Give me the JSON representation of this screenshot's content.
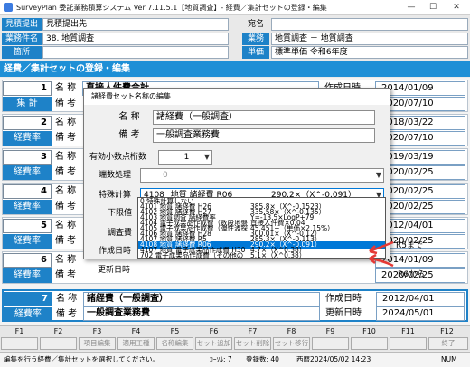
{
  "window": {
    "title": "SurveyPlan 委託業務積算システム Ver 7.11.5.1【地質調査】- 経費／集計セットの登録・編集",
    "min": "—",
    "max": "☐",
    "close": "✕"
  },
  "header": {
    "submitter_label": "見積提出先",
    "submitter_value": "見積提出先",
    "name_label": "宛名",
    "name_value": "",
    "work_label": "業務件名",
    "work_value": "38. 地質調査",
    "gyomu_label": "業務",
    "gyomu_value": "地質調査 － 地質調査",
    "place_label": "箇所",
    "place_value": "",
    "tanka_label": "単価",
    "tanka_value": "標準単価 令和6年度"
  },
  "section_title": "経費／集計セットの登録・編集",
  "rows": [
    {
      "num": "1",
      "kind": "集 計",
      "name_label": "名 称",
      "name": "直接人件費合計",
      "biko_label": "備 考",
      "biko": "",
      "created_label": "作成日時",
      "created": "2014/01/09",
      "updated_label": "更新日時",
      "updated": "2020/07/10"
    },
    {
      "num": "2",
      "kind": "経費率",
      "name_label": "名 称",
      "name": "",
      "biko_label": "備 考",
      "biko": "",
      "created_label": "作成日時",
      "created": "2018/03/22",
      "updated_label": "更新日時",
      "updated": "2020/07/10"
    },
    {
      "num": "3",
      "kind": "経費率",
      "name_label": "名 称",
      "name": "",
      "biko_label": "備 考",
      "biko": "",
      "created_label": "作成日時",
      "created": "2019/03/19",
      "updated_label": "更新日時",
      "updated": "2020/02/25"
    },
    {
      "num": "4",
      "kind": "経費率",
      "name_label": "名 称",
      "name": "",
      "biko_label": "備 考",
      "biko": "",
      "created_label": "作成日時",
      "created": "2020/02/25",
      "updated_label": "更新日時",
      "updated": "2020/02/25"
    },
    {
      "num": "5",
      "kind": "経費率",
      "name_label": "名 称",
      "name": "",
      "biko_label": "備 考",
      "biko": "",
      "created_label": "作成日時",
      "created": "2012/04/01",
      "updated_label": "更新日時",
      "updated": "2020/02/25"
    },
    {
      "num": "6",
      "kind": "経費率",
      "name_label": "名 称",
      "name": "",
      "biko_label": "備 考",
      "biko": "",
      "created_label": "作成日時",
      "created": "2014/01/09",
      "updated_label": "更新日時",
      "updated": "2020/02/25"
    },
    {
      "num": "7",
      "kind": "経費率",
      "name_label": "名 称",
      "name": "諸経費（一般調査）",
      "biko_label": "備 考",
      "biko": "一般調査業務費",
      "created_label": "作成日時",
      "created": "2012/04/01",
      "updated_label": "更新日時",
      "updated": "2024/05/01"
    }
  ],
  "dialog": {
    "title": "諸経費セット名称の編集",
    "name_label": "名 称",
    "name_value": "諸経費（一般調査）",
    "biko_label": "備 考",
    "biko_value": "一般調査業務費",
    "decimals_label": "有効小数点桁数",
    "decimals_value": "1",
    "rounding_label": "端数処理",
    "rounding_value": "0",
    "special_label": "特殊計算",
    "special_code": "4108",
    "special_name": "地質 諸経費 R06",
    "special_formula": "290.2×（X^-0.091）",
    "lower_label": "下限値",
    "adjust_label": "調査費",
    "created_label": "作成日時",
    "updated_label": "更新日時"
  },
  "dropdown_items": [
    {
      "code": "0",
      "name": "特殊計算しない",
      "formula": ""
    },
    {
      "code": "4101",
      "name": "地質 諸経費 H26",
      "formula": "385.8×（X^-0.1523）"
    },
    {
      "code": "4102",
      "name": "地質 諸経費 H27",
      "formula": "335.58×（X^-0.135）"
    },
    {
      "code": "4103",
      "name": "地質調査 諸経費率",
      "formula": "Y=-13.5×LogP+79"
    },
    {
      "code": "4104",
      "name": "電子成果品作成費（数段地盤",
      "formula": "直接人件費×0.04"
    },
    {
      "code": "4105",
      "name": "電子成果品作成費（弾性波探",
      "formula": "45.451+（単価×2.15%）"
    },
    {
      "code": "4106",
      "name": "地質 諸経費 H28",
      "formula": "300.01×（X^-0.12）"
    },
    {
      "code": "4107",
      "name": "地質 諸経費 R5",
      "formula": "285.3×（X^-0.113）"
    },
    {
      "code": "4108",
      "name": "地質 諸経費 R06",
      "formula": "290.2×（X^-0.091）",
      "selected": true
    },
    {
      "code": "4107",
      "name": "地質 電子成果品作成費 H30",
      "formula": "4.7×（X^0.38）"
    },
    {
      "code": "702",
      "name": "電子成果品作成費（その他の",
      "formula": "5.1×（X^0.38）"
    }
  ],
  "annotations": {
    "r5": "R5まで",
    "r6": "R6から"
  },
  "fkeys": [
    {
      "key": "F1",
      "label": ""
    },
    {
      "key": "F2",
      "label": ""
    },
    {
      "key": "F3",
      "label": "項目編集"
    },
    {
      "key": "F4",
      "label": "適用工種"
    },
    {
      "key": "F5",
      "label": "名称編集"
    },
    {
      "key": "F6",
      "label": "セット追加"
    },
    {
      "key": "F7",
      "label": "セット削除"
    },
    {
      "key": "F8",
      "label": "セット移行"
    },
    {
      "key": "F9",
      "label": ""
    },
    {
      "key": "F10",
      "label": ""
    },
    {
      "key": "F11",
      "label": ""
    },
    {
      "key": "F12",
      "label": "終了"
    }
  ],
  "status": {
    "message": "編集を行う経費／集計セットを選択してください。",
    "cursor": "ｶｰｿﾙ: 7",
    "count": "登録数: 40",
    "date": "西暦2024/05/02 14:23",
    "num": "NUM"
  },
  "colors": {
    "accent": "#1e82c8",
    "selection": "#0078d7",
    "annotation": "#e53935"
  }
}
